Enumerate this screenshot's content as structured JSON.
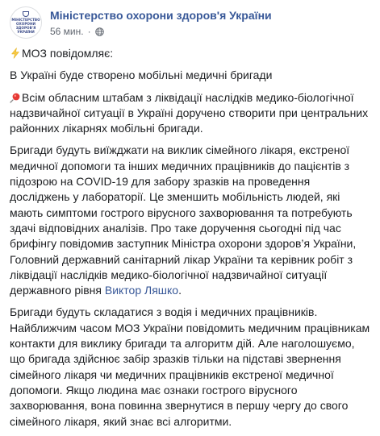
{
  "post": {
    "page_name": "Міністерство охорони здоров'я України",
    "time": "56 мин.",
    "dot": "·",
    "avatar_text": [
      "МІНІСТЕРСТВО",
      "ОХОРОНИ",
      "ЗДОРОВ'Я",
      "УКРАЇНИ"
    ],
    "icons": {
      "privacy": "globe-icon",
      "lead_emoji": "lightning-emoji-icon",
      "pin_emoji": "pushpin-emoji-icon"
    },
    "colors": {
      "link": "#385898",
      "text": "#1c1e21",
      "meta": "#616770"
    },
    "paragraphs": {
      "p1": "МОЗ повідомляє:",
      "p2": "В Україні буде створено мобільні медичні бригади",
      "p3": "Всім обласним штабам з ліквідації наслідків медико-біологічної надзвичайної ситуації в Україні доручено створити при центральних районних лікарнях мобільні бригади.",
      "p4_text": "Бригади будуть виїжджати на виклик сімейного лікаря, екстреної медичної допомоги та інших медичних працівників до пацієнтів з підозрою на COVID-19 для забору зразків на проведення досліджень у лабораторії. Це зменшить мобільність людей, які мають симптоми гострого вірусного захворювання та потребують здачі відповідних аналізів. Про таке доручення сьогодні під час брифінгу повідомив заступник Міністра охорони здоров’я України, Головний державний санітарний лікар України та керівник робіт з ліквідації наслідків медико-біологічної надзвичайної ситуації державного рівня ",
      "p4_mention": "Виктор Ляшко",
      "p4_end": ".",
      "p5": "Бригади будуть складатися з водія і медичних працівників. Найближчим часом МОЗ України повідомить медичним працівникам контакти для виклику бригади та алгоритм дій. Але наголошуємо, що бригада здійснює забір зразків тільки на підставі звернення сімейного лікаря чи медичних працівників екстреної медичної допомоги. Якщо людина має ознаки гострого вірусного захворювання, вона повинна звернутися в першу чергу до свого сімейного лікаря, який знає всі алгоритми."
    }
  }
}
